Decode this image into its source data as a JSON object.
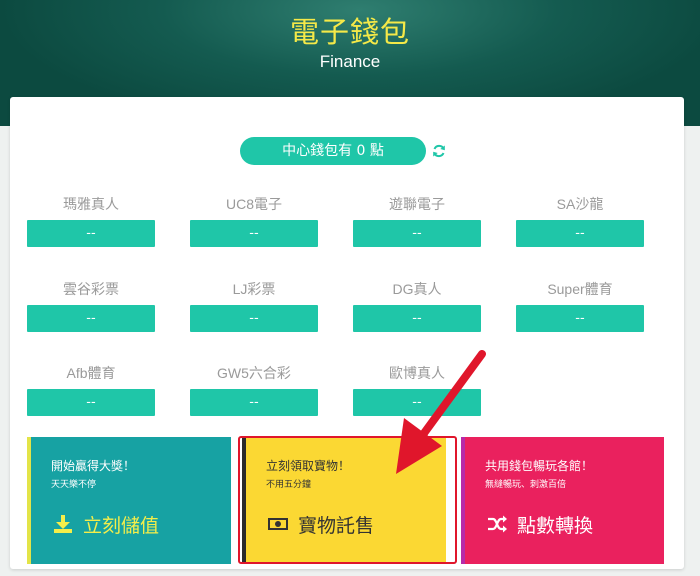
{
  "header": {
    "title": "電子錢包",
    "subtitle": "Finance"
  },
  "wallet": {
    "label": "中心錢包有 0 點"
  },
  "games": [
    {
      "name": "瑪雅真人",
      "value": "--"
    },
    {
      "name": "UC8電子",
      "value": "--"
    },
    {
      "name": "遊聯電子",
      "value": "--"
    },
    {
      "name": "SA沙龍",
      "value": "--"
    },
    {
      "name": "雲谷彩票",
      "value": "--"
    },
    {
      "name": "LJ彩票",
      "value": "--"
    },
    {
      "name": "DG真人",
      "value": "--"
    },
    {
      "name": "Super體育",
      "value": "--"
    },
    {
      "name": "Afb體育",
      "value": "--"
    },
    {
      "name": "GW5六合彩",
      "value": "--"
    },
    {
      "name": "歐博真人",
      "value": "--"
    }
  ],
  "panels": [
    {
      "title": "開始贏得大獎！",
      "subtitle": "天天樂不停",
      "label": "立刻儲值"
    },
    {
      "title": "立刻領取寶物！",
      "subtitle": "不用五分鐘",
      "label": "寶物託售"
    },
    {
      "title": "共用錢包暢玩各館！",
      "subtitle": "無縫暢玩、刺激百倍",
      "label": "點數轉換"
    }
  ],
  "colors": {
    "accent": "#1fc6a8",
    "header": "#145b50",
    "highlight": "#e0162b"
  }
}
